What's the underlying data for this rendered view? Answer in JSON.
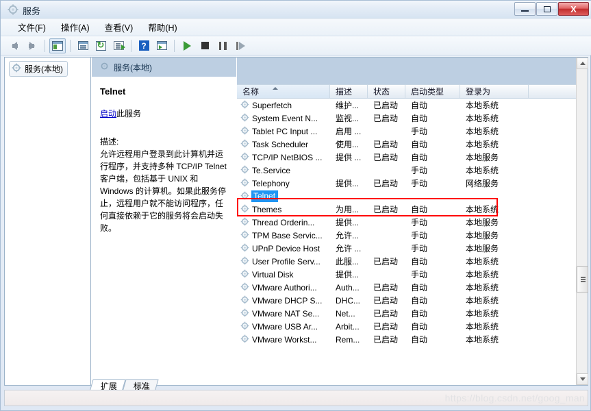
{
  "window": {
    "title": "服务",
    "title_icon": "gear-icon",
    "buttons": {
      "minimize": "–",
      "maximize": "□",
      "close": "X"
    }
  },
  "menu": [
    {
      "label": "文件(F)"
    },
    {
      "label": "操作(A)"
    },
    {
      "label": "查看(V)"
    },
    {
      "label": "帮助(H)"
    }
  ],
  "toolbar": [
    {
      "name": "back-icon",
      "glyph": "arrow-left"
    },
    {
      "name": "forward-icon",
      "glyph": "arrow-right"
    },
    {
      "name": "show-hide-tree-icon",
      "glyph": "panel"
    },
    {
      "name": "properties-icon",
      "glyph": "properties"
    },
    {
      "name": "refresh-icon",
      "glyph": "refresh"
    },
    {
      "name": "export-list-icon",
      "glyph": "export"
    },
    {
      "name": "help-icon",
      "glyph": "question"
    },
    {
      "name": "list-view-icon",
      "glyph": "list"
    },
    {
      "name": "start-service-icon",
      "glyph": "play"
    },
    {
      "name": "stop-service-icon",
      "glyph": "stop"
    },
    {
      "name": "pause-service-icon",
      "glyph": "pause"
    },
    {
      "name": "restart-service-icon",
      "glyph": "restart"
    }
  ],
  "tree": {
    "root_label": "服务(本地)"
  },
  "detail": {
    "pane_header": "服务(本地)",
    "service_name": "Telnet",
    "action_link": "启动",
    "action_suffix": "此服务",
    "description_label": "描述:",
    "description_text": "允许远程用户登录到此计算机并运行程序，并支持多种 TCP/IP Telnet 客户端，包括基于 UNIX 和 Windows 的计算机。如果此服务停止，远程用户就不能访问程序，任何直接依赖于它的服务将会启动失败。"
  },
  "list": {
    "columns": [
      {
        "key": "name",
        "label": "名称",
        "sorted": true
      },
      {
        "key": "description",
        "label": "描述"
      },
      {
        "key": "status",
        "label": "状态"
      },
      {
        "key": "startup",
        "label": "启动类型"
      },
      {
        "key": "logon",
        "label": "登录为"
      }
    ],
    "rows": [
      {
        "name": "Superfetch",
        "description": "维护...",
        "status": "已启动",
        "startup": "自动",
        "logon": "本地系统",
        "selected": false
      },
      {
        "name": "System Event N...",
        "description": "监视...",
        "status": "已启动",
        "startup": "自动",
        "logon": "本地系统",
        "selected": false
      },
      {
        "name": "Tablet PC Input ...",
        "description": "启用 ...",
        "status": "",
        "startup": "手动",
        "logon": "本地系统",
        "selected": false
      },
      {
        "name": "Task Scheduler",
        "description": "使用...",
        "status": "已启动",
        "startup": "自动",
        "logon": "本地系统",
        "selected": false
      },
      {
        "name": "TCP/IP NetBIOS ...",
        "description": "提供 ...",
        "status": "已启动",
        "startup": "自动",
        "logon": "本地服务",
        "selected": false
      },
      {
        "name": "Te.Service",
        "description": "",
        "status": "",
        "startup": "手动",
        "logon": "本地系统",
        "selected": false
      },
      {
        "name": "Telephony",
        "description": "提供...",
        "status": "已启动",
        "startup": "手动",
        "logon": "网络服务",
        "selected": false
      },
      {
        "name": "Telnet",
        "description": "",
        "status": "",
        "startup": "",
        "logon": "",
        "selected": true
      },
      {
        "name": "Themes",
        "description": "为用...",
        "status": "已启动",
        "startup": "自动",
        "logon": "本地系统",
        "selected": false
      },
      {
        "name": "Thread Orderin...",
        "description": "提供...",
        "status": "",
        "startup": "手动",
        "logon": "本地服务",
        "selected": false
      },
      {
        "name": "TPM Base Servic...",
        "description": "允许...",
        "status": "",
        "startup": "手动",
        "logon": "本地服务",
        "selected": false
      },
      {
        "name": "UPnP Device Host",
        "description": "允许 ...",
        "status": "",
        "startup": "手动",
        "logon": "本地服务",
        "selected": false
      },
      {
        "name": "User Profile Serv...",
        "description": "此服...",
        "status": "已启动",
        "startup": "自动",
        "logon": "本地系统",
        "selected": false
      },
      {
        "name": "Virtual Disk",
        "description": "提供...",
        "status": "",
        "startup": "手动",
        "logon": "本地系统",
        "selected": false
      },
      {
        "name": "VMware Authori...",
        "description": "Auth...",
        "status": "已启动",
        "startup": "自动",
        "logon": "本地系统",
        "selected": false
      },
      {
        "name": "VMware DHCP S...",
        "description": "DHC...",
        "status": "已启动",
        "startup": "自动",
        "logon": "本地系统",
        "selected": false
      },
      {
        "name": "VMware NAT Se...",
        "description": "Net...",
        "status": "已启动",
        "startup": "自动",
        "logon": "本地系统",
        "selected": false
      },
      {
        "name": "VMware USB Ar...",
        "description": "Arbit...",
        "status": "已启动",
        "startup": "自动",
        "logon": "本地系统",
        "selected": false
      },
      {
        "name": "VMware Workst...",
        "description": "Rem...",
        "status": "已启动",
        "startup": "自动",
        "logon": "本地系统",
        "selected": false
      }
    ]
  },
  "tabs": [
    {
      "label": "扩展",
      "active": true
    },
    {
      "label": "标准",
      "active": false
    }
  ],
  "watermark": "https://blog.csdn.net/goog_man",
  "colors": {
    "selection_blue": "#2196f3",
    "annotation_red": "#ff0000",
    "link_blue": "#0000c8",
    "header_band": "#bdcfe2"
  }
}
